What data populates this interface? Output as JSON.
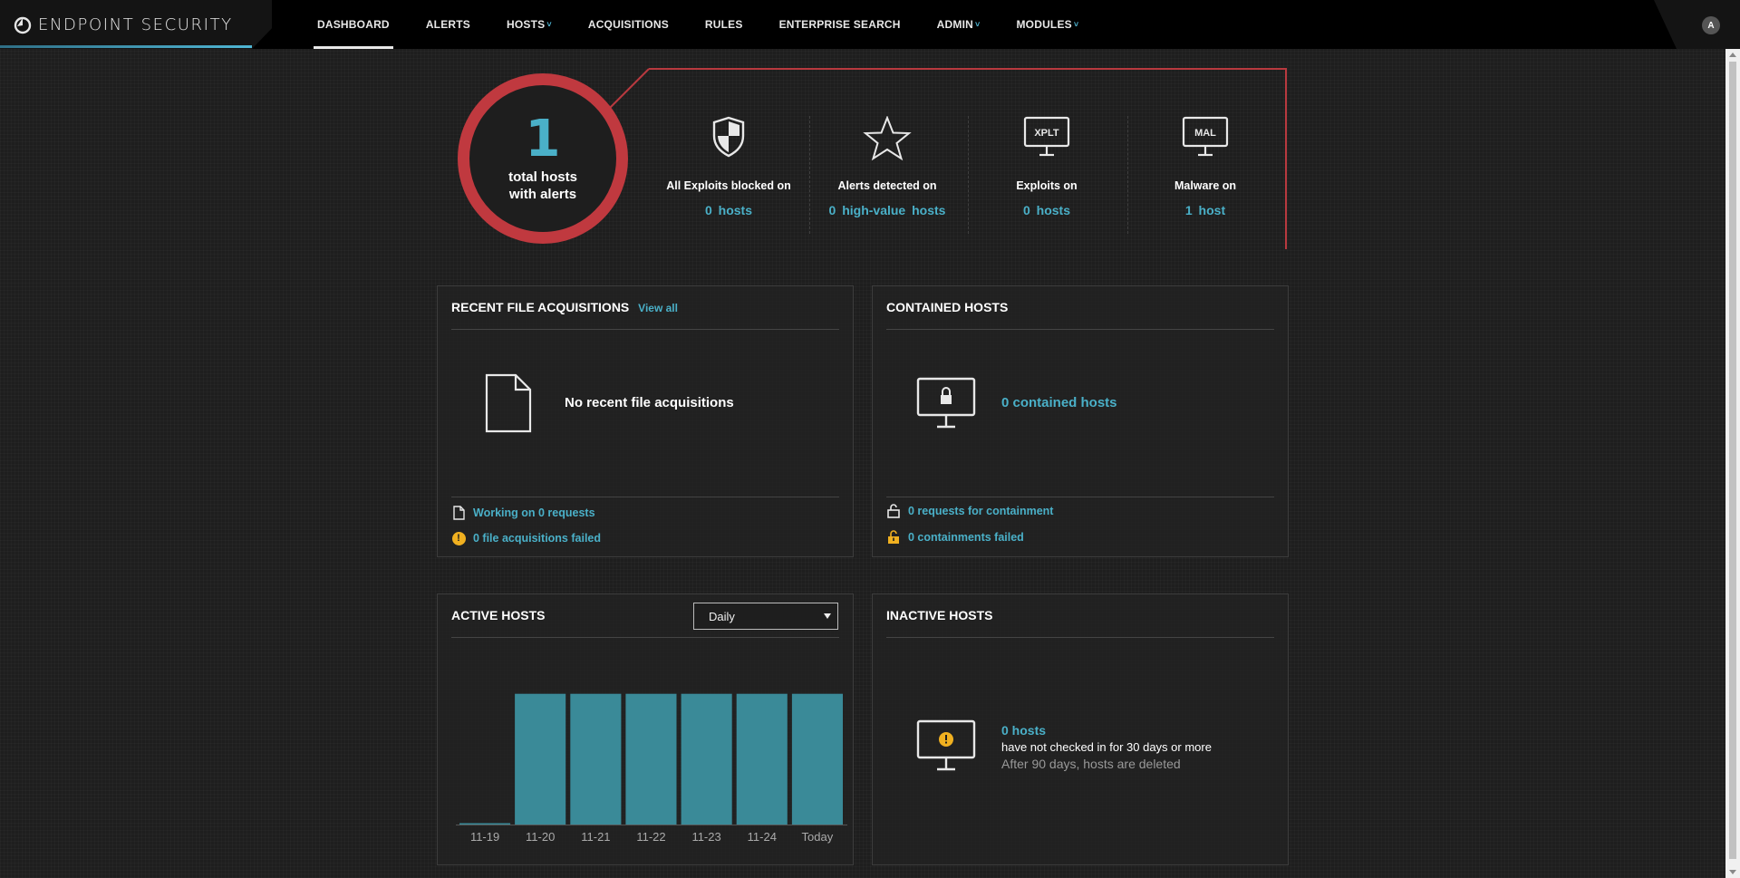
{
  "app": {
    "title": "ENDPOINT SECURITY",
    "accent_color": "#4ab0c8",
    "alert_color": "#c0393f",
    "warning_color": "#f0b020"
  },
  "nav": {
    "items": [
      {
        "label": "DASHBOARD",
        "active": true
      },
      {
        "label": "ALERTS"
      },
      {
        "label": "HOSTS",
        "caret": true
      },
      {
        "label": "ACQUISITIONS"
      },
      {
        "label": "RULES"
      },
      {
        "label": "ENTERPRISE SEARCH"
      },
      {
        "label": "ADMIN",
        "caret": true
      },
      {
        "label": "MODULES",
        "caret": true
      }
    ],
    "caret_icon": "˅",
    "avatar": "A"
  },
  "summary": {
    "total_hosts": "1",
    "total_label": "total hosts with alerts",
    "stats": [
      {
        "icon": "shield-icon",
        "title": "All Exploits blocked on",
        "value": "0 hosts"
      },
      {
        "icon": "star-icon",
        "title": "Alerts detected on",
        "value": "0 high-value hosts"
      },
      {
        "icon": "monitor-xplt-icon",
        "badge": "XPLT",
        "title": "Exploits on",
        "value": "0 hosts"
      },
      {
        "icon": "monitor-mal-icon",
        "badge": "MAL",
        "title": "Malware on",
        "value": "1 host"
      }
    ]
  },
  "acquisitions": {
    "title": "RECENT FILE ACQUISITIONS",
    "view_all": "View all",
    "empty_message": "No recent file acquisitions",
    "working": "Working on 0 requests",
    "failed": "0 file acquisitions failed"
  },
  "contained": {
    "title": "CONTAINED HOSTS",
    "count": "0 contained hosts",
    "requests": "0 requests for containment",
    "failed": "0 containments failed"
  },
  "active": {
    "title": "ACTIVE HOSTS",
    "interval": "Daily"
  },
  "inactive": {
    "title": "INACTIVE HOSTS",
    "count": "0 hosts",
    "description": "have not checked in for 30 days or more",
    "note": "After 90 days, hosts are deleted"
  },
  "chart_data": {
    "type": "bar",
    "categories": [
      "11-19",
      "11-20",
      "11-21",
      "11-22",
      "11-23",
      "11-24",
      "Today"
    ],
    "values": [
      0,
      1,
      1,
      1,
      1,
      1,
      1
    ],
    "ylim": [
      0,
      1.15
    ],
    "grid": false,
    "bar_color": "#3a8a98"
  }
}
